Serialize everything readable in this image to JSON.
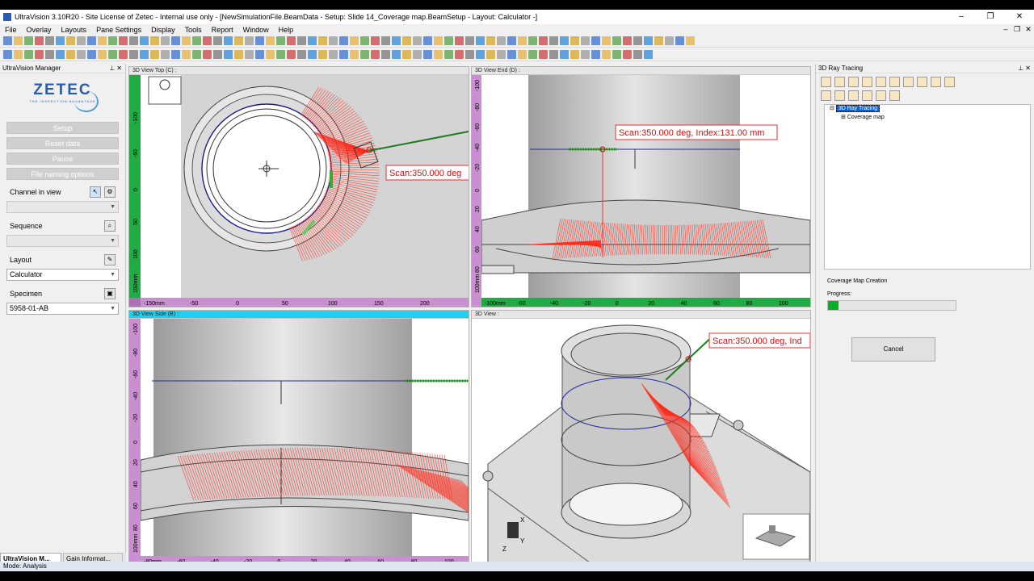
{
  "window": {
    "title": "UltraVision 3.10R20 - Site License of Zetec - Internal use only - [NewSimulationFile.BeamData - Setup: Slide 14_Coverage map.BeamSetup - Layout: Calculator -]",
    "min": "–",
    "max": "❐",
    "close": "✕"
  },
  "menu": [
    "File",
    "Overlay",
    "Layouts",
    "Pane Settings",
    "Display",
    "Tools",
    "Report",
    "Window",
    "Help"
  ],
  "menu_right": [
    "–",
    "❐",
    "✕"
  ],
  "left_panel": {
    "title": "UltraVision Manager",
    "pin": "⊥ ✕",
    "logo_text": "ZETEC",
    "logo_sub": "THE INSPECTION ADVANTAGE",
    "buttons": [
      "Setup",
      "Reset data",
      "Pause",
      "File naming options"
    ],
    "channel_label": "Channel in view",
    "sequence_label": "Sequence",
    "layout_label": "Layout",
    "layout_value": "Calculator",
    "specimen_label": "Specimen",
    "specimen_value": "5958-01-AB"
  },
  "left_tabs": [
    "UltraVision M...",
    "Gain Informat..."
  ],
  "views": {
    "top": {
      "title": "3D View Top (C)  :",
      "x_ticks": [
        "-150mm",
        "-50",
        "0",
        "50",
        "100",
        "150",
        "200"
      ],
      "y_ticks": [
        "-100",
        "-50",
        "0",
        "50",
        "100",
        "150mm"
      ],
      "annotation": "Scan:350.000 deg"
    },
    "end": {
      "title": "3D View End (D)  :",
      "x_ticks": [
        "-100mm",
        "-60",
        "-40",
        "-20",
        "0",
        "20",
        "40",
        "60",
        "80",
        "100"
      ],
      "y_ticks": [
        "-100",
        "-80",
        "-60",
        "-40",
        "-20",
        "0",
        "20",
        "40",
        "60",
        "80",
        "100mm"
      ],
      "annotation": "Scan:350.000 deg, Index:131.00 mm"
    },
    "side": {
      "title": "3D View Side (B)  :",
      "x_ticks": [
        "-80mm",
        "-60",
        "-40",
        "-20",
        "0",
        "20",
        "40",
        "60",
        "80",
        "100"
      ],
      "y_ticks": [
        "-100",
        "-80",
        "-60",
        "-40",
        "-20",
        "0",
        "20",
        "40",
        "60",
        "80",
        "100mm"
      ]
    },
    "iso": {
      "title": "3D View  :",
      "annotation": "Scan:350.000 deg, Ind",
      "axes": {
        "x": "X",
        "y": "Y",
        "z": "Z"
      }
    }
  },
  "right_panel": {
    "title": "3D Ray Tracing",
    "pin": "⊥ ✕",
    "tree_root": "3D Ray Tracing",
    "tree_child": "Coverage map",
    "coverage_title": "Coverage Map Creation",
    "progress_label": "Progress:",
    "progress_fraction": 0.08,
    "cancel": "Cancel"
  },
  "status": "Mode: Analysis",
  "colors": {
    "accent": "#1ed0ef",
    "ray": "#ff2a1a",
    "progress": "#06b025",
    "ruler_green": "#22aa44",
    "ruler_purple": "#b070b8"
  }
}
